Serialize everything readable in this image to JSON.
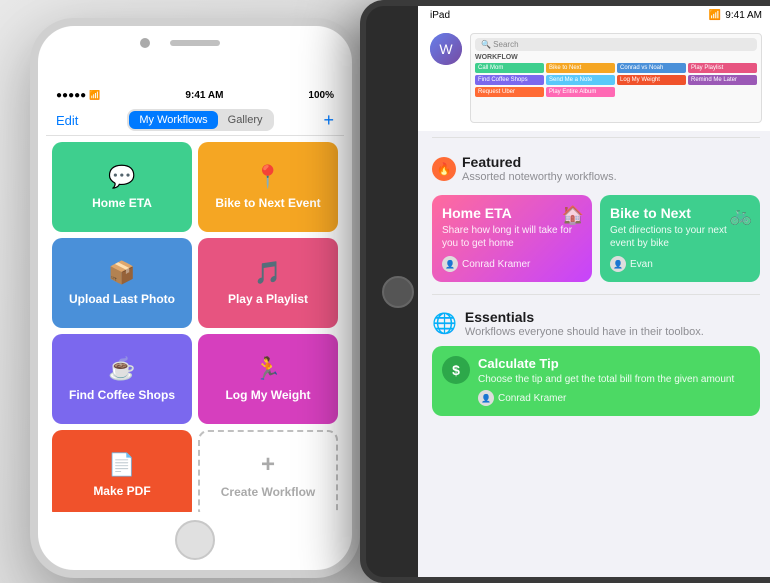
{
  "phone": {
    "status_bar": {
      "dots": "•••••",
      "wifi": "WiFi",
      "time": "9:41 AM",
      "battery": "100%"
    },
    "nav": {
      "edit_label": "Edit",
      "tab_workflows": "My Workflows",
      "tab_gallery": "Gallery",
      "plus": "+"
    },
    "tiles": [
      {
        "id": "home-eta",
        "label": "Home ETA",
        "icon": "💬",
        "color": "teal"
      },
      {
        "id": "bike-next-event",
        "label": "Bike to Next Event",
        "icon": "📍",
        "color": "orange"
      },
      {
        "id": "upload-last-photo",
        "label": "Upload Last Photo",
        "icon": "📦",
        "color": "blue"
      },
      {
        "id": "play-playlist",
        "label": "Play a Playlist",
        "icon": "🎵",
        "color": "pink"
      },
      {
        "id": "find-coffee",
        "label": "Find Coffee Shops",
        "icon": "☕",
        "color": "purple"
      },
      {
        "id": "log-weight",
        "label": "Log My Weight",
        "icon": "🏃",
        "color": "magenta"
      },
      {
        "id": "make-pdf",
        "label": "Make PDF",
        "icon": "📄",
        "color": "red-orange"
      },
      {
        "id": "create-workflow",
        "label": "Create Workflow",
        "icon": "+",
        "color": "dashed"
      }
    ]
  },
  "ipad": {
    "status_bar": {
      "left": "iPad",
      "wifi": "WiFi",
      "time": "9:41 AM"
    },
    "preview": {
      "search_placeholder": "Search"
    },
    "featured_section": {
      "icon": "🔥",
      "title": "Featured",
      "subtitle": "Assorted noteworthy workflows."
    },
    "cards": [
      {
        "id": "home-eta-card",
        "title": "Home ETA",
        "description": "Share how long it will take for you to get home",
        "author": "Conrad Kramer",
        "color": "pink-purple",
        "card_icon": "🏠"
      },
      {
        "id": "bike-card",
        "title": "Bike to Next",
        "description": "Get directions to your next event by bike",
        "author": "Evan",
        "color": "teal",
        "card_icon": "🚲"
      }
    ],
    "essentials_section": {
      "globe_icon": "🌐",
      "title": "Essentials",
      "subtitle": "Workflows everyone should have in their toolbox."
    },
    "tip_card": {
      "title": "Calculate Tip",
      "description": "Choose the tip and get the total bill from the given amount",
      "author": "Conrad Kramer",
      "dollar_sign": "$"
    }
  }
}
